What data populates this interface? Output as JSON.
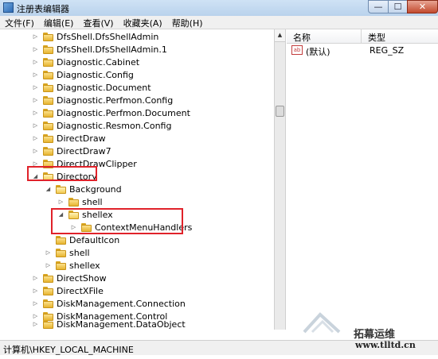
{
  "window": {
    "title": "注册表编辑器",
    "min": "—",
    "max": "☐",
    "close": "✕"
  },
  "menu": [
    {
      "label": "文件(F)"
    },
    {
      "label": "编辑(E)"
    },
    {
      "label": "查看(V)"
    },
    {
      "label": "收藏夹(A)"
    },
    {
      "label": "帮助(H)"
    }
  ],
  "tree": [
    {
      "label": "DfsShell.DfsShellAdmin",
      "expander": "▷"
    },
    {
      "label": "DfsShell.DfsShellAdmin.1",
      "expander": "▷"
    },
    {
      "label": "Diagnostic.Cabinet",
      "expander": "▷"
    },
    {
      "label": "Diagnostic.Config",
      "expander": "▷"
    },
    {
      "label": "Diagnostic.Document",
      "expander": "▷"
    },
    {
      "label": "Diagnostic.Perfmon.Config",
      "expander": "▷"
    },
    {
      "label": "Diagnostic.Perfmon.Document",
      "expander": "▷"
    },
    {
      "label": "Diagnostic.Resmon.Config",
      "expander": "▷"
    },
    {
      "label": "DirectDraw",
      "expander": "▷"
    },
    {
      "label": "DirectDraw7",
      "expander": "▷"
    },
    {
      "label": "DirectDrawClipper",
      "expander": "▷"
    },
    {
      "label": "Directory",
      "expander": "◢"
    },
    {
      "label": "Background",
      "expander": "◢"
    },
    {
      "label": "shell",
      "expander": "▷"
    },
    {
      "label": "shellex",
      "expander": "◢"
    },
    {
      "label": "ContextMenuHandlers",
      "expander": "▷"
    },
    {
      "label": "DefaultIcon",
      "expander": ""
    },
    {
      "label": "shell",
      "expander": "▷"
    },
    {
      "label": "shellex",
      "expander": "▷"
    },
    {
      "label": "DirectShow",
      "expander": "▷"
    },
    {
      "label": "DirectXFile",
      "expander": "▷"
    },
    {
      "label": "DiskManagement.Connection",
      "expander": "▷"
    },
    {
      "label": "DiskManagement.Control",
      "expander": "▷"
    },
    {
      "label": "DiskManagement.DataObject",
      "expander": "▷"
    }
  ],
  "list": {
    "columns": [
      "名称",
      "类型"
    ],
    "rows": [
      {
        "name": "(默认)",
        "type": "REG_SZ",
        "icon": "ab"
      }
    ]
  },
  "scrollbar": {
    "up": "▲"
  },
  "status": "计算机\\HKEY_LOCAL_MACHINE",
  "watermark": {
    "text": "拓幕运维",
    "url": "www.tlltd.cn"
  },
  "highlight_color": "#e0222a"
}
